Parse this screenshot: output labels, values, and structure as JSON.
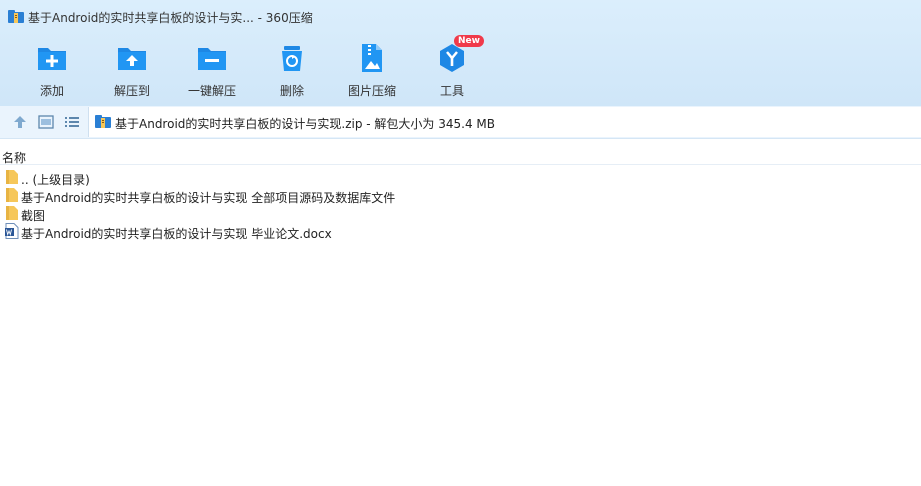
{
  "window": {
    "title": "基于Android的实时共享白板的设计与实... - 360压缩",
    "app_icon": "archive-app-icon"
  },
  "toolbar": {
    "items": [
      {
        "label": "添加",
        "icon": "add-folder-icon"
      },
      {
        "label": "解压到",
        "icon": "extract-to-folder-icon"
      },
      {
        "label": "一键解压",
        "icon": "one-click-extract-icon"
      },
      {
        "label": "删除",
        "icon": "recycle-bin-icon"
      },
      {
        "label": "图片压缩",
        "icon": "image-compress-icon"
      },
      {
        "label": "工具",
        "icon": "tools-icon",
        "badge": "New"
      }
    ]
  },
  "addressbar": {
    "path": "基于Android的实时共享白板的设计与实现.zip - 解包大小为 345.4 MB",
    "buttons": [
      "up-arrow-icon",
      "details-view-icon",
      "list-view-icon"
    ]
  },
  "filelist": {
    "column_name": "名称",
    "rows": [
      {
        "name": ".. (上级目录)",
        "icon": "folder-icon"
      },
      {
        "name": "基于Android的实时共享白板的设计与实现 全部项目源码及数据库文件",
        "icon": "folder-icon"
      },
      {
        "name": "截图",
        "icon": "folder-icon"
      },
      {
        "name": "基于Android的实时共享白板的设计与实现 毕业论文.docx",
        "icon": "word-doc-icon"
      }
    ]
  },
  "colors": {
    "accent": "#1e88e5",
    "toolbar_bg": "#d4e9fa",
    "badge": "#f03a4a",
    "folder": "#f6c75a"
  }
}
